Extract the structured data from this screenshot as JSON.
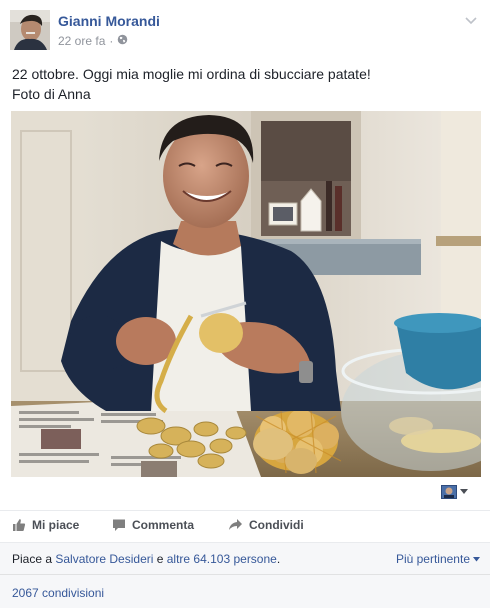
{
  "post": {
    "author": "Gianni Morandi",
    "time": "22 ore fa",
    "separator": "·",
    "privacy_icon": "globe-icon",
    "text_line1": "22 ottobre. Oggi mia moglie mi ordina di sbucciare patate!",
    "text_line2": "Foto di Anna",
    "photo_icon": "photo-of-man-peeling-potatoes"
  },
  "actions": {
    "like": "Mi piace",
    "comment": "Commenta",
    "share": "Condividi"
  },
  "likes": {
    "prefix": "Piace a ",
    "first_person": "Salvatore Desideri",
    "middle": " e ",
    "others": "altre 64.103 persone",
    "suffix": ".",
    "sort_label": "Più pertinente"
  },
  "shares": {
    "label": "2067 condivisioni"
  },
  "colors": {
    "link": "#365899",
    "meta": "#90949c",
    "text": "#1d2129",
    "action": "#4b4f56"
  }
}
